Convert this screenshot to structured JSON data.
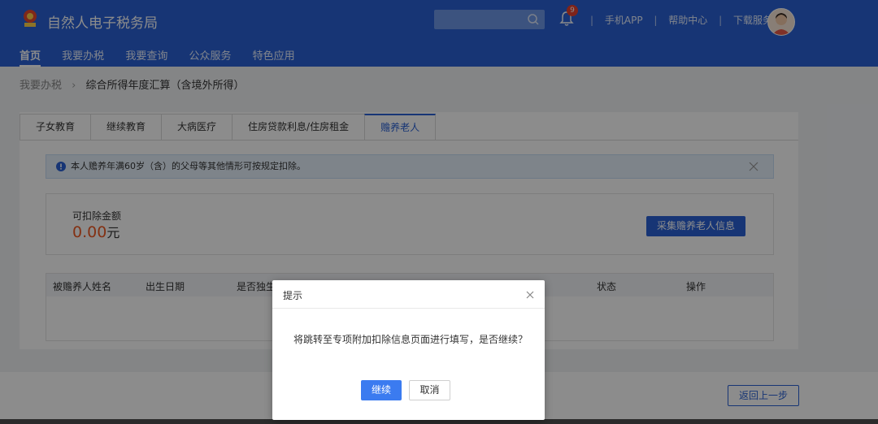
{
  "header": {
    "app_title": "自然人电子税务局",
    "search_placeholder": "",
    "notification_count": "9",
    "links": [
      "手机APP",
      "帮助中心",
      "下载服务"
    ],
    "nav": [
      "首页",
      "我要办税",
      "我要查询",
      "公众服务",
      "特色应用"
    ],
    "active_nav": "首页",
    "brand_color": "#2a62d6"
  },
  "breadcrumb": {
    "parent": "我要办税",
    "current": "综合所得年度汇算（含境外所得）"
  },
  "tabs": [
    "子女教育",
    "继续教育",
    "大病医疗",
    "住房贷款利息/住房租金",
    "赡养老人"
  ],
  "active_tab": "赡养老人",
  "alert": {
    "text": "本人赡养年满60岁（含）的父母等其他情形可按规定扣除。"
  },
  "amount": {
    "label": "可扣除金额",
    "value": "0.00",
    "unit": "元",
    "value_color": "#f05a23"
  },
  "collect_button": "采集赡养老人信息",
  "table": {
    "columns": [
      "被赡养人姓名",
      "出生日期",
      "是否独生",
      "状态",
      "操作"
    ]
  },
  "footer": {
    "back_button": "返回上一步"
  },
  "dialog": {
    "title": "提示",
    "message": "将跳转至专项附加扣除信息页面进行填写，是否继续？",
    "confirm": "继续",
    "cancel": "取消"
  }
}
